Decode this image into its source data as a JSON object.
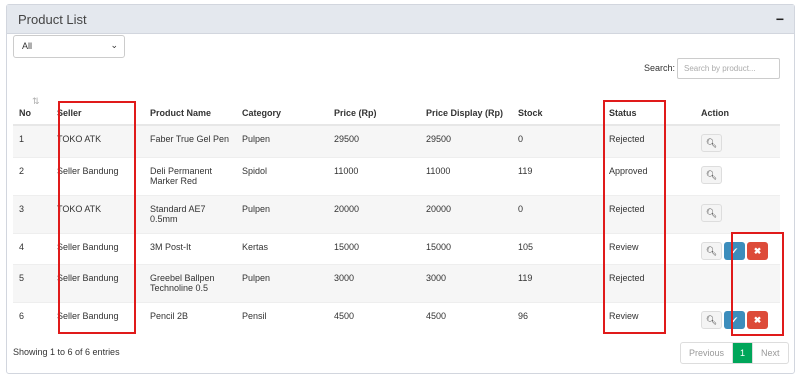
{
  "panel": {
    "title": "Product List",
    "collapse_icon": "minus-icon",
    "collapse_glyph": "−"
  },
  "filter": {
    "selected": "All"
  },
  "search": {
    "label": "Search:",
    "placeholder": "Search by product..."
  },
  "table": {
    "headers": [
      "No",
      "Seller",
      "Product Name",
      "Category",
      "Price (Rp)",
      "Price Display (Rp)",
      "Stock",
      "Status",
      "Action"
    ],
    "rows": [
      {
        "no": "1",
        "seller": "TOKO ATK",
        "product": "Faber True Gel Pen",
        "category": "Pulpen",
        "price": "29500",
        "price_display": "29500",
        "stock": "0",
        "status": "Rejected"
      },
      {
        "no": "2",
        "seller": "Seller Bandung",
        "product": "Deli Permanent Marker Red",
        "category": "Spidol",
        "price": "11000",
        "price_display": "11000",
        "stock": "119",
        "status": "Approved"
      },
      {
        "no": "3",
        "seller": "TOKO ATK",
        "product": "Standard AE7 0.5mm",
        "category": "Pulpen",
        "price": "20000",
        "price_display": "20000",
        "stock": "0",
        "status": "Rejected"
      },
      {
        "no": "4",
        "seller": "Seller Bandung",
        "product": "3M Post-It",
        "category": "Kertas",
        "price": "15000",
        "price_display": "15000",
        "stock": "105",
        "status": "Review"
      },
      {
        "no": "5",
        "seller": "Seller Bandung",
        "product": "Greebel Ballpen Technoline 0.5",
        "category": "Pulpen",
        "price": "3000",
        "price_display": "3000",
        "stock": "119",
        "status": "Rejected"
      },
      {
        "no": "6",
        "seller": "Seller Bandung",
        "product": "Pencil 2B",
        "category": "Pensil",
        "price": "4500",
        "price_display": "4500",
        "stock": "96",
        "status": "Review"
      }
    ]
  },
  "footer": {
    "info": "Showing 1 to 6 of 6 entries",
    "prev": "Previous",
    "page": "1",
    "next": "Next"
  },
  "colors": {
    "approve": "#3c8dbc",
    "reject": "#dd4b39",
    "active_page": "#00a65a",
    "highlight": "#e01a1a"
  }
}
